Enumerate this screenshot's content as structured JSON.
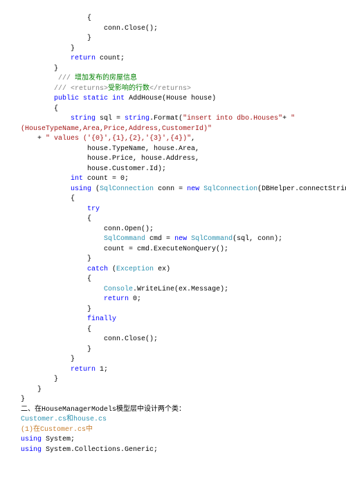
{
  "lines": [
    {
      "indent": 16,
      "spans": [
        {
          "t": "{",
          "c": "c-black"
        }
      ]
    },
    {
      "indent": 20,
      "spans": [
        {
          "t": "conn.Close();",
          "c": "c-black"
        }
      ]
    },
    {
      "indent": 16,
      "spans": [
        {
          "t": "}",
          "c": "c-black"
        }
      ]
    },
    {
      "indent": 12,
      "spans": [
        {
          "t": "}",
          "c": "c-black"
        }
      ]
    },
    {
      "indent": 12,
      "spans": [
        {
          "t": "return",
          "c": "c-blue"
        },
        {
          "t": " count;",
          "c": "c-black"
        }
      ]
    },
    {
      "indent": 8,
      "spans": [
        {
          "t": "}",
          "c": "c-black"
        }
      ]
    },
    {
      "indent": 8,
      "spans": [
        {
          "t": " /// ",
          "c": "c-gray"
        },
        {
          "t": "增加发布的房屋信息",
          "c": "c-green"
        }
      ]
    },
    {
      "indent": 8,
      "spans": [
        {
          "t": "/// ",
          "c": "c-gray"
        },
        {
          "t": "<returns>",
          "c": "c-gray"
        },
        {
          "t": "受影响的行数",
          "c": "c-green"
        },
        {
          "t": "</returns>",
          "c": "c-gray"
        }
      ]
    },
    {
      "indent": 8,
      "spans": [
        {
          "t": "public",
          "c": "c-blue"
        },
        {
          "t": " ",
          "c": "c-black"
        },
        {
          "t": "static",
          "c": "c-blue"
        },
        {
          "t": " ",
          "c": "c-black"
        },
        {
          "t": "int",
          "c": "c-blue"
        },
        {
          "t": " AddHouse(House house)",
          "c": "c-black"
        }
      ]
    },
    {
      "indent": 8,
      "spans": [
        {
          "t": "{",
          "c": "c-black"
        }
      ]
    },
    {
      "indent": 12,
      "spans": [
        {
          "t": "string",
          "c": "c-blue"
        },
        {
          "t": " sql = ",
          "c": "c-black"
        },
        {
          "t": "string",
          "c": "c-blue"
        },
        {
          "t": ".Format(",
          "c": "c-black"
        },
        {
          "t": "\"insert into dbo.Houses\"",
          "c": "c-red"
        },
        {
          "t": "+ ",
          "c": "c-black"
        },
        {
          "t": "\"",
          "c": "c-red"
        }
      ]
    },
    {
      "indent": 0,
      "spans": [
        {
          "t": "(HouseTypeName,Area,Price,Address,CustomerId)\"",
          "c": "c-red"
        }
      ]
    },
    {
      "indent": 4,
      "spans": [
        {
          "t": "+ ",
          "c": "c-black"
        },
        {
          "t": "\" values ('{0}',{1},{2},'{3}',{4})\"",
          "c": "c-red"
        },
        {
          "t": ",",
          "c": "c-black"
        }
      ]
    },
    {
      "indent": 16,
      "spans": [
        {
          "t": "house.TypeName, house.Area,",
          "c": "c-black"
        }
      ]
    },
    {
      "indent": 16,
      "spans": [
        {
          "t": "house.Price, house.Address,",
          "c": "c-black"
        }
      ]
    },
    {
      "indent": 16,
      "spans": [
        {
          "t": "house.Customer.Id);",
          "c": "c-black"
        }
      ]
    },
    {
      "indent": 12,
      "spans": [
        {
          "t": "int",
          "c": "c-blue"
        },
        {
          "t": " count = 0;",
          "c": "c-black"
        }
      ]
    },
    {
      "indent": 12,
      "spans": [
        {
          "t": "using",
          "c": "c-blue"
        },
        {
          "t": " (",
          "c": "c-black"
        },
        {
          "t": "SqlConnection",
          "c": "c-teal"
        },
        {
          "t": " conn = ",
          "c": "c-black"
        },
        {
          "t": "new",
          "c": "c-blue"
        },
        {
          "t": " ",
          "c": "c-black"
        },
        {
          "t": "SqlConnection",
          "c": "c-teal"
        },
        {
          "t": "(DBHelper.connectString))",
          "c": "c-black"
        }
      ]
    },
    {
      "indent": 12,
      "spans": [
        {
          "t": "{",
          "c": "c-black"
        }
      ]
    },
    {
      "indent": 16,
      "spans": [
        {
          "t": "try",
          "c": "c-blue"
        }
      ]
    },
    {
      "indent": 16,
      "spans": [
        {
          "t": "{",
          "c": "c-black"
        }
      ]
    },
    {
      "indent": 20,
      "spans": [
        {
          "t": "conn.Open();",
          "c": "c-black"
        }
      ]
    },
    {
      "indent": 20,
      "spans": [
        {
          "t": "SqlCommand",
          "c": "c-teal"
        },
        {
          "t": " cmd = ",
          "c": "c-black"
        },
        {
          "t": "new",
          "c": "c-blue"
        },
        {
          "t": " ",
          "c": "c-black"
        },
        {
          "t": "SqlCommand",
          "c": "c-teal"
        },
        {
          "t": "(sql, conn);",
          "c": "c-black"
        }
      ]
    },
    {
      "indent": 20,
      "spans": [
        {
          "t": "count = cmd.ExecuteNonQuery();",
          "c": "c-black"
        }
      ]
    },
    {
      "indent": 16,
      "spans": [
        {
          "t": "}",
          "c": "c-black"
        }
      ]
    },
    {
      "indent": 16,
      "spans": [
        {
          "t": "catch",
          "c": "c-blue"
        },
        {
          "t": " (",
          "c": "c-black"
        },
        {
          "t": "Exception",
          "c": "c-teal"
        },
        {
          "t": " ex)",
          "c": "c-black"
        }
      ]
    },
    {
      "indent": 16,
      "spans": [
        {
          "t": "{",
          "c": "c-black"
        }
      ]
    },
    {
      "indent": 20,
      "spans": [
        {
          "t": "Console",
          "c": "c-teal"
        },
        {
          "t": ".WriteLine(ex.Message);",
          "c": "c-black"
        }
      ]
    },
    {
      "indent": 20,
      "spans": [
        {
          "t": "return",
          "c": "c-blue"
        },
        {
          "t": " 0;",
          "c": "c-black"
        }
      ]
    },
    {
      "indent": 16,
      "spans": [
        {
          "t": "}",
          "c": "c-black"
        }
      ]
    },
    {
      "indent": 16,
      "spans": [
        {
          "t": "finally",
          "c": "c-blue"
        }
      ]
    },
    {
      "indent": 16,
      "spans": [
        {
          "t": "{",
          "c": "c-black"
        }
      ]
    },
    {
      "indent": 20,
      "spans": [
        {
          "t": "conn.Close();",
          "c": "c-black"
        }
      ]
    },
    {
      "indent": 16,
      "spans": [
        {
          "t": "}",
          "c": "c-black"
        }
      ]
    },
    {
      "indent": 12,
      "spans": [
        {
          "t": "}",
          "c": "c-black"
        }
      ]
    },
    {
      "indent": 12,
      "spans": [
        {
          "t": "return",
          "c": "c-blue"
        },
        {
          "t": " 1;",
          "c": "c-black"
        }
      ]
    },
    {
      "indent": 8,
      "spans": [
        {
          "t": "}",
          "c": "c-black"
        }
      ]
    },
    {
      "indent": 4,
      "spans": [
        {
          "t": "}",
          "c": "c-black"
        }
      ]
    },
    {
      "indent": 0,
      "spans": [
        {
          "t": "}",
          "c": "c-black"
        }
      ]
    },
    {
      "indent": 0,
      "spans": [
        {
          "t": "二、在HouseManagerModels模型层中设计两个类：",
          "c": "c-black"
        }
      ]
    },
    {
      "indent": 0,
      "spans": [
        {
          "t": "Customer.cs和house.cs",
          "c": "c-teal"
        }
      ]
    },
    {
      "indent": 0,
      "spans": [
        {
          "t": "(1)在Customer.cs中",
          "c": "c-orange"
        }
      ]
    },
    {
      "indent": 0,
      "spans": [
        {
          "t": "using",
          "c": "c-blue"
        },
        {
          "t": " System;",
          "c": "c-black"
        }
      ]
    },
    {
      "indent": 0,
      "spans": [
        {
          "t": "using",
          "c": "c-blue"
        },
        {
          "t": " System.Collections.Generic;",
          "c": "c-black"
        }
      ]
    }
  ]
}
